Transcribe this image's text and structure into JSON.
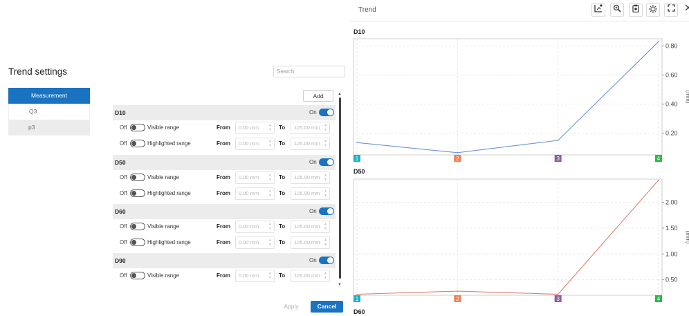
{
  "settings": {
    "title": "Trend settings",
    "search_placeholder": "Search",
    "add_label": "Add",
    "apply_label": "Apply",
    "cancel_label": "Cancel",
    "categories": [
      {
        "label": "Measurement",
        "active": true
      },
      {
        "label": "Q3",
        "active": false
      },
      {
        "label": "p3",
        "active": false
      }
    ],
    "groups": [
      {
        "name": "D10",
        "on_label": "On",
        "enabled": true,
        "rows": [
          {
            "off_label": "Off",
            "label": "Visible range",
            "from_label": "From",
            "from_value": "0.00 mm",
            "to_label": "To",
            "to_value": "125.00 mm"
          },
          {
            "off_label": "Off",
            "label": "Highlighted range",
            "from_label": "From",
            "from_value": "0.00 mm",
            "to_label": "To",
            "to_value": "125.00 mm"
          }
        ]
      },
      {
        "name": "D50",
        "on_label": "On",
        "enabled": true,
        "rows": [
          {
            "off_label": "Off",
            "label": "Visible range",
            "from_label": "From",
            "from_value": "0.00 mm",
            "to_label": "To",
            "to_value": "125.00 mm"
          },
          {
            "off_label": "Off",
            "label": "Highlighted range",
            "from_label": "From",
            "from_value": "0.00 mm",
            "to_label": "To",
            "to_value": "125.00 mm"
          }
        ]
      },
      {
        "name": "D60",
        "on_label": "On",
        "enabled": true,
        "rows": [
          {
            "off_label": "Off",
            "label": "Visible range",
            "from_label": "From",
            "from_value": "0.00 mm",
            "to_label": "To",
            "to_value": "125.00 mm"
          },
          {
            "off_label": "Off",
            "label": "Highlighted range",
            "from_label": "From",
            "from_value": "0.00 mm",
            "to_label": "To",
            "to_value": "125.00 mm"
          }
        ]
      },
      {
        "name": "D90",
        "on_label": "On",
        "enabled": true,
        "rows": [
          {
            "off_label": "Off",
            "label": "Visible range",
            "from_label": "From",
            "from_value": "0.00 mm",
            "to_label": "To",
            "to_value": "125.00 mm"
          }
        ]
      }
    ]
  },
  "trend": {
    "title": "Trend",
    "toolbar_icons": [
      "export-chart-icon",
      "zoom-icon",
      "clipboard-icon",
      "settings-gear-icon",
      "fullscreen-icon",
      "close-icon"
    ],
    "colors": {
      "primary": "#1a73c1",
      "d10_line": "#6b93d6",
      "d50_line": "#e08070"
    }
  },
  "chart_data": [
    {
      "type": "line",
      "title": "D10",
      "x": [
        "1",
        "2",
        "3",
        "4"
      ],
      "x_badge_colors": [
        "#17b3c9",
        "#f07f50",
        "#8b5ea8",
        "#2db84a"
      ],
      "series": [
        {
          "values": [
            0.135,
            0.065,
            0.15,
            0.83
          ],
          "color": "#6b93d6"
        }
      ],
      "ylabel": "(mm)",
      "ylim": [
        0.05,
        0.85
      ],
      "yticks": [
        "0.20",
        "0.40",
        "0.60",
        "0.80"
      ],
      "grid": true
    },
    {
      "type": "line",
      "title": "D50",
      "x": [
        "1",
        "2",
        "3",
        "4"
      ],
      "x_badge_colors": [
        "#17b3c9",
        "#f07f50",
        "#8b5ea8",
        "#2db84a"
      ],
      "series": [
        {
          "values": [
            0.22,
            0.28,
            0.22,
            2.43
          ],
          "color": "#e08070"
        }
      ],
      "ylabel": "(mm)",
      "ylim": [
        0.2,
        2.45
      ],
      "yticks": [
        "0.50",
        "1.00",
        "1.50",
        "2.00"
      ],
      "grid": true
    }
  ],
  "next_chart_label": "D60"
}
